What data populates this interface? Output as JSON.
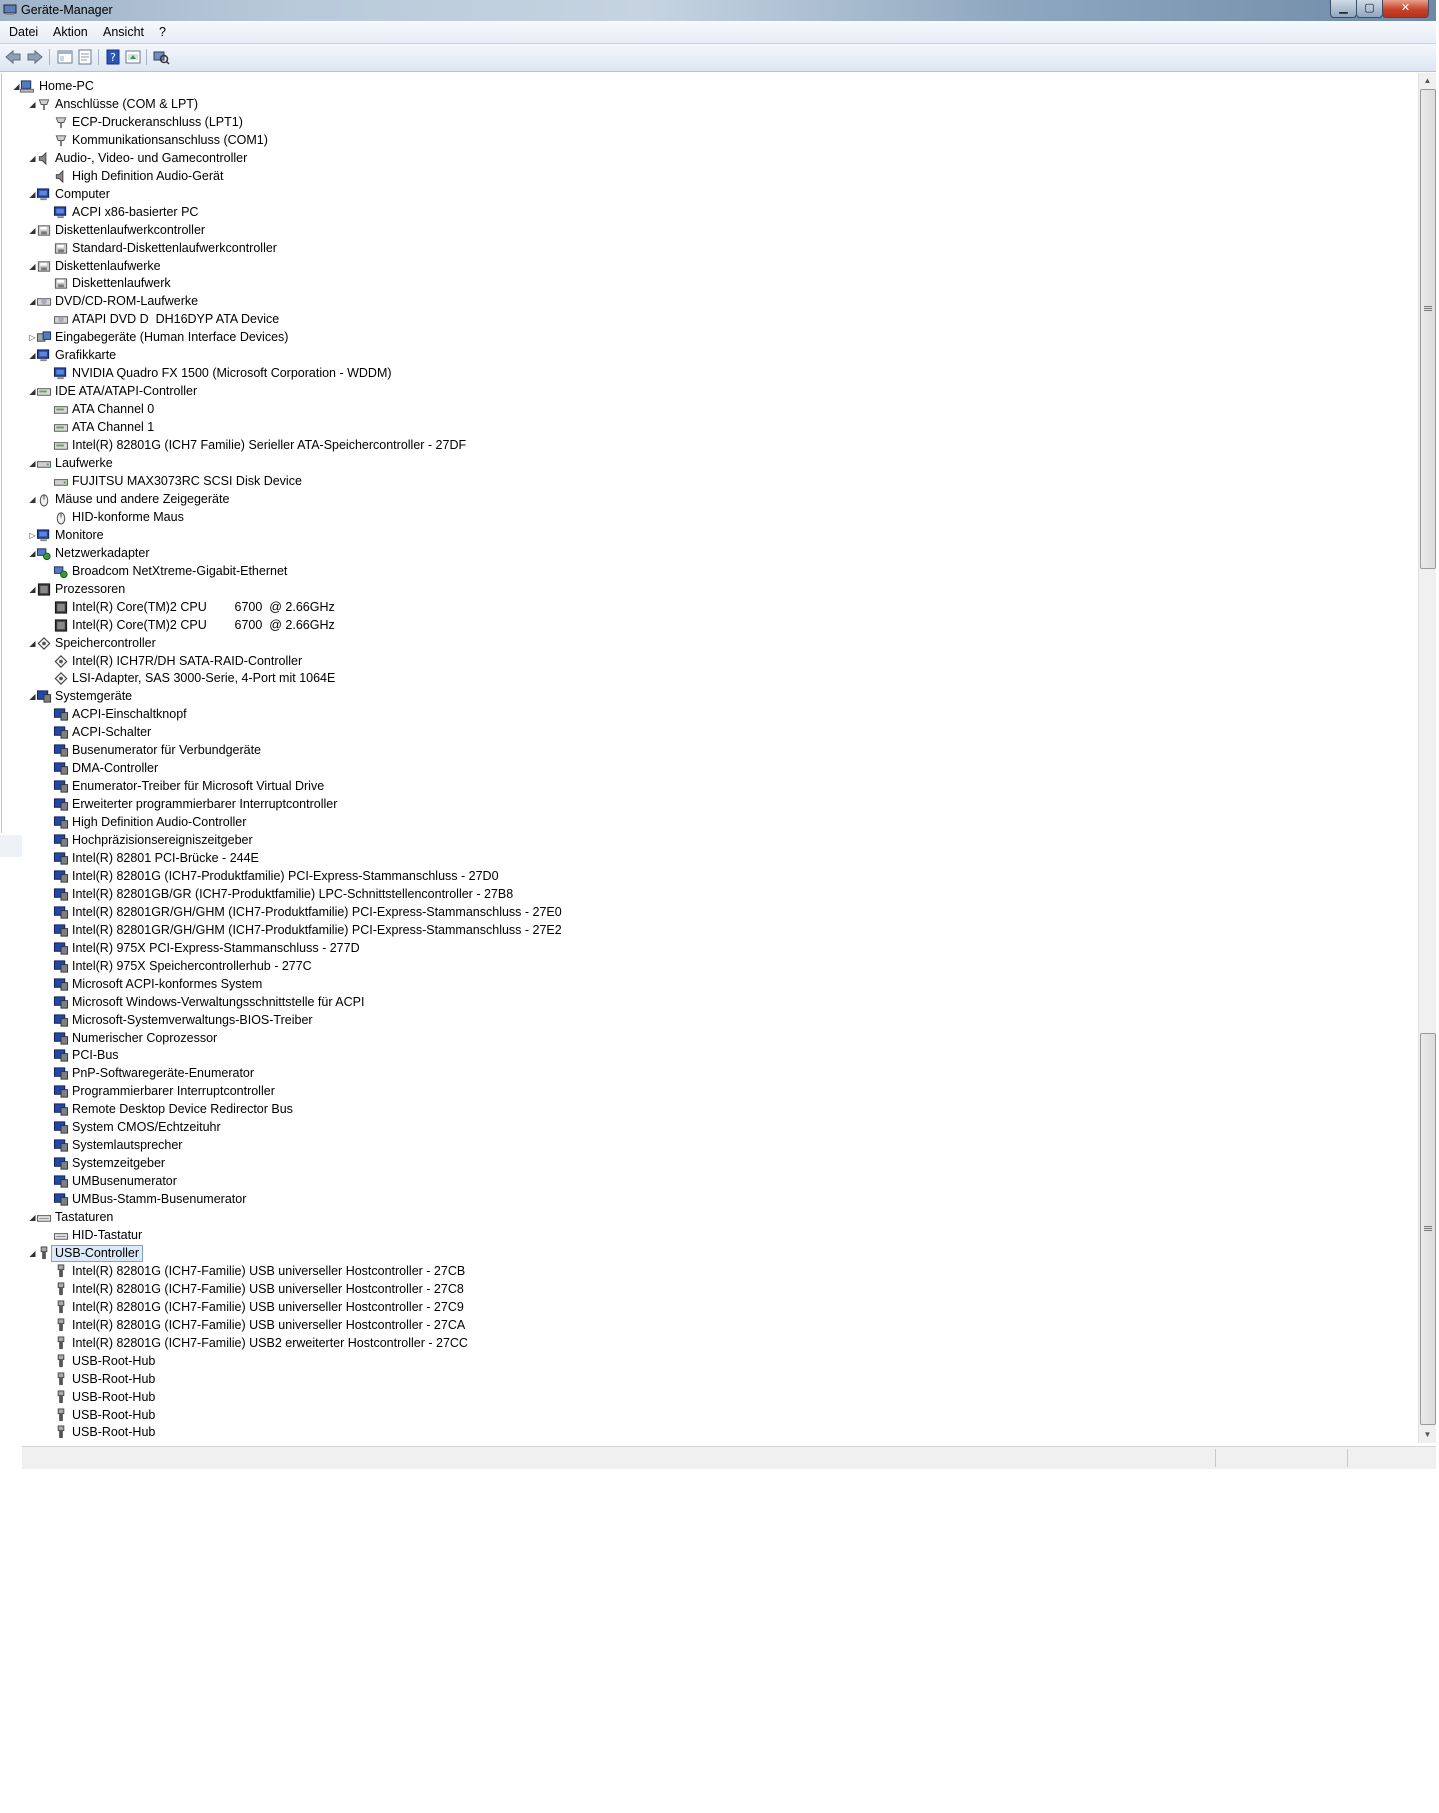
{
  "window": {
    "title": "Geräte-Manager"
  },
  "menu": {
    "datei": "Datei",
    "aktion": "Aktion",
    "ansicht": "Ansicht",
    "help": "?"
  },
  "toolbar": {
    "buttons": [
      "back-icon",
      "forward-icon",
      "properties-icon",
      "console-tree-icon",
      "help-icon",
      "update-driver-icon",
      "scan-hardware-icon"
    ]
  },
  "tree": {
    "rows": [
      {
        "level": 0,
        "exp": "open",
        "icon": "computer",
        "label": "Home-PC"
      },
      {
        "level": 1,
        "exp": "open",
        "icon": "port",
        "label": "Anschlüsse (COM & LPT)"
      },
      {
        "level": 2,
        "exp": "none",
        "icon": "port",
        "label": "ECP-Druckeranschluss (LPT1)"
      },
      {
        "level": 2,
        "exp": "none",
        "icon": "port",
        "label": "Kommunikationsanschluss (COM1)"
      },
      {
        "level": 1,
        "exp": "open",
        "icon": "audio",
        "label": "Audio-, Video- und Gamecontroller"
      },
      {
        "level": 2,
        "exp": "none",
        "icon": "audio",
        "label": "High Definition Audio-Gerät"
      },
      {
        "level": 1,
        "exp": "open",
        "icon": "monitor",
        "label": "Computer"
      },
      {
        "level": 2,
        "exp": "none",
        "icon": "monitor",
        "label": "ACPI x86-basierter PC"
      },
      {
        "level": 1,
        "exp": "open",
        "icon": "floppy",
        "label": "Diskettenlaufwerkcontroller"
      },
      {
        "level": 2,
        "exp": "none",
        "icon": "floppy",
        "label": "Standard-Diskettenlaufwerkcontroller"
      },
      {
        "level": 1,
        "exp": "open",
        "icon": "floppy",
        "label": "Diskettenlaufwerke"
      },
      {
        "level": 2,
        "exp": "none",
        "icon": "floppy",
        "label": "Diskettenlaufwerk"
      },
      {
        "level": 1,
        "exp": "open",
        "icon": "dvd",
        "label": "DVD/CD-ROM-Laufwerke"
      },
      {
        "level": 2,
        "exp": "none",
        "icon": "dvd",
        "label": "ATAPI DVD D  DH16DYP ATA Device"
      },
      {
        "level": 1,
        "exp": "closed",
        "icon": "hid",
        "label": "Eingabegeräte (Human Interface Devices)"
      },
      {
        "level": 1,
        "exp": "open",
        "icon": "monitor",
        "label": "Grafikkarte"
      },
      {
        "level": 2,
        "exp": "none",
        "icon": "monitor",
        "label": "NVIDIA Quadro FX 1500 (Microsoft Corporation - WDDM)"
      },
      {
        "level": 1,
        "exp": "open",
        "icon": "ide",
        "label": "IDE ATA/ATAPI-Controller"
      },
      {
        "level": 2,
        "exp": "none",
        "icon": "ide",
        "label": "ATA Channel 0"
      },
      {
        "level": 2,
        "exp": "none",
        "icon": "ide",
        "label": "ATA Channel 1"
      },
      {
        "level": 2,
        "exp": "none",
        "icon": "ide",
        "label": "Intel(R) 82801G (ICH7 Familie) Serieller ATA-Speichercontroller - 27DF"
      },
      {
        "level": 1,
        "exp": "open",
        "icon": "disk",
        "label": "Laufwerke"
      },
      {
        "level": 2,
        "exp": "none",
        "icon": "disk",
        "label": "FUJITSU MAX3073RC SCSI Disk Device"
      },
      {
        "level": 1,
        "exp": "open",
        "icon": "mouse",
        "label": "Mäuse und andere Zeigegeräte"
      },
      {
        "level": 2,
        "exp": "none",
        "icon": "mouse",
        "label": "HID-konforme Maus"
      },
      {
        "level": 1,
        "exp": "closed",
        "icon": "monitor",
        "label": "Monitore"
      },
      {
        "level": 1,
        "exp": "open",
        "icon": "network",
        "label": "Netzwerkadapter"
      },
      {
        "level": 2,
        "exp": "none",
        "icon": "network",
        "label": "Broadcom NetXtreme-Gigabit-Ethernet"
      },
      {
        "level": 1,
        "exp": "open",
        "icon": "cpu",
        "label": "Prozessoren"
      },
      {
        "level": 2,
        "exp": "none",
        "icon": "cpu",
        "label": "Intel(R) Core(TM)2 CPU        6700  @ 2.66GHz"
      },
      {
        "level": 2,
        "exp": "none",
        "icon": "cpu",
        "label": "Intel(R) Core(TM)2 CPU        6700  @ 2.66GHz"
      },
      {
        "level": 1,
        "exp": "open",
        "icon": "storage",
        "label": "Speichercontroller"
      },
      {
        "level": 2,
        "exp": "none",
        "icon": "storage",
        "label": "Intel(R) ICH7R/DH SATA-RAID-Controller"
      },
      {
        "level": 2,
        "exp": "none",
        "icon": "storage",
        "label": "LSI-Adapter, SAS 3000-Serie, 4-Port mit 1064E"
      },
      {
        "level": 1,
        "exp": "open",
        "icon": "system",
        "label": "Systemgeräte"
      },
      {
        "level": 2,
        "exp": "none",
        "icon": "system",
        "label": "ACPI-Einschaltknopf"
      },
      {
        "level": 2,
        "exp": "none",
        "icon": "system",
        "label": "ACPI-Schalter"
      },
      {
        "level": 2,
        "exp": "none",
        "icon": "system",
        "label": "Busenumerator für Verbundgeräte"
      },
      {
        "level": 2,
        "exp": "none",
        "icon": "system",
        "label": "DMA-Controller"
      },
      {
        "level": 2,
        "exp": "none",
        "icon": "system",
        "label": "Enumerator-Treiber für Microsoft Virtual Drive"
      },
      {
        "level": 2,
        "exp": "none",
        "icon": "system",
        "label": "Erweiterter programmierbarer Interruptcontroller"
      },
      {
        "level": 2,
        "exp": "none",
        "icon": "system",
        "label": "High Definition Audio-Controller"
      },
      {
        "level": 2,
        "exp": "none",
        "icon": "system",
        "label": "Hochpräzisionsereigniszeitgeber"
      },
      {
        "level": 2,
        "exp": "none",
        "icon": "system",
        "label": "Intel(R) 82801 PCI-Brücke - 244E"
      },
      {
        "level": 2,
        "exp": "none",
        "icon": "system",
        "label": "Intel(R) 82801G (ICH7-Produktfamilie) PCI-Express-Stammanschluss - 27D0"
      },
      {
        "level": 2,
        "exp": "none",
        "icon": "system",
        "label": "Intel(R) 82801GB/GR (ICH7-Produktfamilie) LPC-Schnittstellencontroller - 27B8"
      },
      {
        "level": 2,
        "exp": "none",
        "icon": "system",
        "label": "Intel(R) 82801GR/GH/GHM (ICH7-Produktfamilie) PCI-Express-Stammanschluss - 27E0"
      },
      {
        "level": 2,
        "exp": "none",
        "icon": "system",
        "label": "Intel(R) 82801GR/GH/GHM (ICH7-Produktfamilie) PCI-Express-Stammanschluss - 27E2"
      },
      {
        "level": 2,
        "exp": "none",
        "icon": "system",
        "label": "Intel(R) 975X PCI-Express-Stammanschluss - 277D"
      },
      {
        "level": 2,
        "exp": "none",
        "icon": "system",
        "label": "Intel(R) 975X Speichercontrollerhub - 277C"
      },
      {
        "level": 2,
        "exp": "none",
        "icon": "system",
        "label": "Microsoft ACPI-konformes System"
      },
      {
        "level": 2,
        "exp": "none",
        "icon": "system",
        "label": "Microsoft Windows-Verwaltungsschnittstelle für ACPI"
      },
      {
        "level": 2,
        "exp": "none",
        "icon": "system",
        "label": "Microsoft-Systemverwaltungs-BIOS-Treiber"
      },
      {
        "level": 2,
        "exp": "none",
        "icon": "system",
        "label": "Numerischer Coprozessor"
      },
      {
        "level": 2,
        "exp": "none",
        "icon": "system",
        "label": "PCI-Bus"
      },
      {
        "level": 2,
        "exp": "none",
        "icon": "system",
        "label": "PnP-Softwaregeräte-Enumerator"
      },
      {
        "level": 2,
        "exp": "none",
        "icon": "system",
        "label": "Programmierbarer Interruptcontroller"
      },
      {
        "level": 2,
        "exp": "none",
        "icon": "system",
        "label": "Remote Desktop Device Redirector Bus"
      },
      {
        "level": 2,
        "exp": "none",
        "icon": "system",
        "label": "System CMOS/Echtzeituhr"
      },
      {
        "level": 2,
        "exp": "none",
        "icon": "system",
        "label": "Systemlautsprecher"
      },
      {
        "level": 2,
        "exp": "none",
        "icon": "system",
        "label": "Systemzeitgeber"
      },
      {
        "level": 2,
        "exp": "none",
        "icon": "system",
        "label": "UMBusenumerator"
      },
      {
        "level": 2,
        "exp": "none",
        "icon": "system",
        "label": "UMBus-Stamm-Busenumerator"
      },
      {
        "level": 1,
        "exp": "open",
        "icon": "keyboard",
        "label": "Tastaturen"
      },
      {
        "level": 2,
        "exp": "none",
        "icon": "keyboard",
        "label": "HID-Tastatur"
      },
      {
        "level": 1,
        "exp": "open",
        "icon": "usb",
        "label": "USB-Controller",
        "selected": true
      },
      {
        "level": 2,
        "exp": "none",
        "icon": "usb",
        "label": "Intel(R) 82801G (ICH7-Familie) USB universeller Hostcontroller - 27CB"
      },
      {
        "level": 2,
        "exp": "none",
        "icon": "usb",
        "label": "Intel(R) 82801G (ICH7-Familie) USB universeller Hostcontroller - 27C8"
      },
      {
        "level": 2,
        "exp": "none",
        "icon": "usb",
        "label": "Intel(R) 82801G (ICH7-Familie) USB universeller Hostcontroller - 27C9"
      },
      {
        "level": 2,
        "exp": "none",
        "icon": "usb",
        "label": "Intel(R) 82801G (ICH7-Familie) USB universeller Hostcontroller - 27CA"
      },
      {
        "level": 2,
        "exp": "none",
        "icon": "usb",
        "label": "Intel(R) 82801G (ICH7-Familie) USB2 erweiterter Hostcontroller - 27CC"
      },
      {
        "level": 2,
        "exp": "none",
        "icon": "usb",
        "label": "USB-Root-Hub"
      },
      {
        "level": 2,
        "exp": "none",
        "icon": "usb",
        "label": "USB-Root-Hub"
      },
      {
        "level": 2,
        "exp": "none",
        "icon": "usb",
        "label": "USB-Root-Hub"
      },
      {
        "level": 2,
        "exp": "none",
        "icon": "usb",
        "label": "USB-Root-Hub"
      },
      {
        "level": 2,
        "exp": "none",
        "icon": "usb",
        "label": "USB-Root-Hub"
      }
    ]
  },
  "colors": {
    "selection_bg": "#dbe9fa",
    "selection_border": "#7da2ce",
    "device_blue": "#1f3f9e"
  }
}
